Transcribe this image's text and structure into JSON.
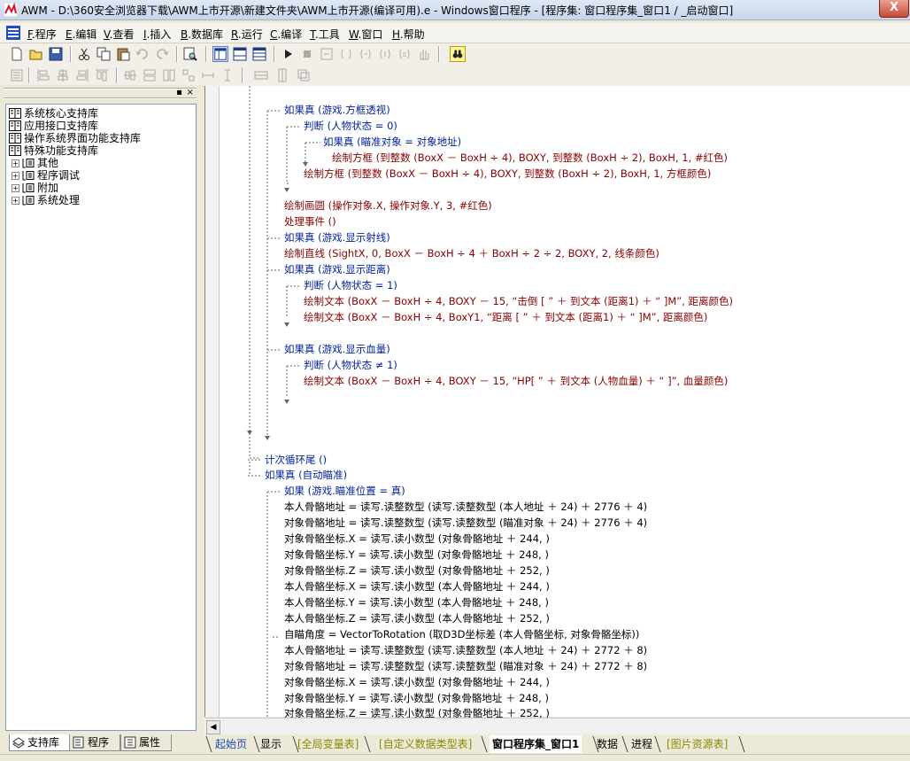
{
  "window": {
    "title": "AWM - D:\\360安全浏览器下载\\AWM上市开源\\新建文件夹\\AWM上市开源(编译可用).e - Windows窗口程序 - [程序集: 窗口程序集_窗口1 / _启动窗口]",
    "close_label": "X"
  },
  "menu": [
    {
      "key": "F",
      "label": ".程序"
    },
    {
      "key": "E",
      "label": ".编辑"
    },
    {
      "key": "V",
      "label": ".查看"
    },
    {
      "key": "I",
      "label": ".插入"
    },
    {
      "key": "B",
      "label": ".数据库"
    },
    {
      "key": "R",
      "label": ".运行"
    },
    {
      "key": "C",
      "label": ".编译"
    },
    {
      "key": "T",
      "label": ".工具"
    },
    {
      "key": "W",
      "label": ".窗口"
    },
    {
      "key": "H",
      "label": ".帮助"
    }
  ],
  "panel": {
    "pin": "▪",
    "close": "×"
  },
  "tree": [
    {
      "label": "系统核心支持库",
      "type": "book"
    },
    {
      "label": "应用接口支持库",
      "type": "book"
    },
    {
      "label": "操作系统界面功能支持库",
      "type": "book"
    },
    {
      "label": "特殊功能支持库",
      "type": "book"
    },
    {
      "label": "其他",
      "type": "folder"
    },
    {
      "label": "程序调试",
      "type": "folder"
    },
    {
      "label": "附加",
      "type": "folder"
    },
    {
      "label": "系统处理",
      "type": "folder"
    }
  ],
  "left_tabs": [
    {
      "label": "支持库"
    },
    {
      "label": "程序"
    },
    {
      "label": "属性"
    }
  ],
  "code": [
    "如果真 (游戏.方框透视)",
    "判断 (人物状态 = 0)",
    "如果真 (瞄准对象 = 对象地址)",
    "绘制方框 (到整数 (BoxX － BoxH ÷ 4), BOXY, 到整数 (BoxH ÷ 2), BoxH, 1, #红色)",
    "绘制方框 (到整数 (BoxX － BoxH ÷ 4), BOXY, 到整数 (BoxH ÷ 2), BoxH, 1, 方框颜色)",
    "绘制画圆 (操作对象.X, 操作对象.Y, 3, #红色)",
    "处理事件 ()",
    "如果真 (游戏.显示射线)",
    "绘制直线 (SightX, 0, BoxX － BoxH ÷ 4 ＋ BoxH ÷ 2 ÷ 2, BOXY, 2, 线条颜色)",
    "如果真 (游戏.显示距离)",
    "判断 (人物状态 = 1)",
    "绘制文本 (BoxX － BoxH ÷ 4, BOXY － 15, “击倒 [ ” ＋ 到文本 (距离1) ＋ “ ]M”, 距离颜色)",
    "绘制文本 (BoxX － BoxH ÷ 4, BoxY1, “距离 [ ” ＋ 到文本 (距离1) ＋ “ ]M”, 距离颜色)",
    "如果真 (游戏.显示血量)",
    "判断 (人物状态 ≠ 1)",
    "绘制文本 (BoxX － BoxH ÷ 4, BOXY － 15, “HP[ ” ＋ 到文本 (人物血量) ＋ “ ]”, 血量颜色)",
    "计次循环尾 ()",
    "如果真 (自动瞄准)",
    "如果 (游戏.瞄准位置 = 真)",
    "本人骨骼地址 = 读写.读整数型 (读写.读整数型 (本人地址 ＋ 24) ＋ 2776 ＋ 4)",
    "对象骨骼地址 = 读写.读整数型 (读写.读整数型 (瞄准对象 ＋ 24) ＋ 2776 ＋ 4)",
    "对象骨骼坐标.X = 读写.读小数型 (对象骨骼地址 ＋ 244, )",
    "对象骨骼坐标.Y = 读写.读小数型 (对象骨骼地址 ＋ 248, )",
    "对象骨骼坐标.Z = 读写.读小数型 (对象骨骼地址 ＋ 252, )",
    "本人骨骼坐标.X = 读写.读小数型 (本人骨骼地址 ＋ 244, )",
    "本人骨骼坐标.Y = 读写.读小数型 (本人骨骼地址 ＋ 248, )",
    "本人骨骼坐标.Z = 读写.读小数型 (本人骨骼地址 ＋ 252, )",
    "自瞄角度 = VectorToRotation (取D3D坐标差 (本人骨骼坐标, 对象骨骼坐标))",
    "本人骨骼地址 = 读写.读整数型 (读写.读整数型 (本人地址 ＋ 24) ＋ 2772 ＋ 8)",
    "对象骨骼地址 = 读写.读整数型 (读写.读整数型 (瞄准对象 ＋ 24) ＋ 2772 ＋ 8)",
    "对象骨骼坐标.X = 读写.读小数型 (对象骨骼地址 ＋ 244, )",
    "对象骨骼坐标.Y = 读写.读小数型 (对象骨骼地址 ＋ 248, )",
    "对象骨骼坐标.Z = 读写.读小数型 (对象骨骼地址 ＋ 252, )"
  ],
  "bottom_tabs": [
    {
      "label": "起始页"
    },
    {
      "label": "显示"
    },
    {
      "label": "[全局变量表]"
    },
    {
      "label": "[自定义数据类型表]"
    },
    {
      "label": "窗口程序集_窗口1"
    },
    {
      "label": "数据"
    },
    {
      "label": "进程"
    },
    {
      "label": "[图片资源表]"
    }
  ],
  "colors": {
    "keyword": "#001f9e",
    "function": "#8b0000",
    "tab_blue": "#1a4bb5",
    "tab_olive": "#8a8a00"
  }
}
